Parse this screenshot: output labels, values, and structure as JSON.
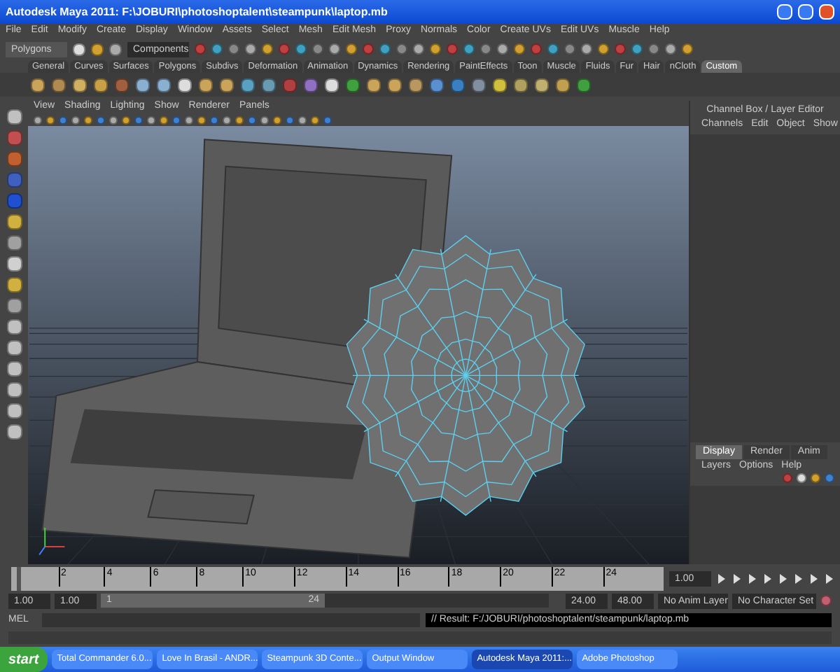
{
  "window": {
    "title": "Autodesk Maya 2011: F:\\JOBURI\\photoshoptalent\\steampunk\\laptop.mb"
  },
  "menu": [
    "File",
    "Edit",
    "Modify",
    "Create",
    "Display",
    "Window",
    "Assets",
    "Select",
    "Mesh",
    "Edit Mesh",
    "Proxy",
    "Normals",
    "Color",
    "Create UVs",
    "Edit UVs",
    "Muscle",
    "Help"
  ],
  "status_line": {
    "mode": "Polygons",
    "selection_mask": "Components"
  },
  "shelf_tabs": [
    {
      "label": "General",
      "selected": false
    },
    {
      "label": "Curves",
      "selected": false
    },
    {
      "label": "Surfaces",
      "selected": false
    },
    {
      "label": "Polygons",
      "selected": false
    },
    {
      "label": "Subdivs",
      "selected": false
    },
    {
      "label": "Deformation",
      "selected": false
    },
    {
      "label": "Animation",
      "selected": false
    },
    {
      "label": "Dynamics",
      "selected": false
    },
    {
      "label": "Rendering",
      "selected": false
    },
    {
      "label": "PaintEffects",
      "selected": false
    },
    {
      "label": "Toon",
      "selected": false
    },
    {
      "label": "Muscle",
      "selected": false
    },
    {
      "label": "Fluids",
      "selected": false
    },
    {
      "label": "Fur",
      "selected": false
    },
    {
      "label": "Hair",
      "selected": false
    },
    {
      "label": "nCloth",
      "selected": false
    },
    {
      "label": "Custom",
      "selected": true
    }
  ],
  "viewport_menu": [
    "View",
    "Shading",
    "Lighting",
    "Show",
    "Renderer",
    "Panels"
  ],
  "channel_box": {
    "title": "Channel Box / Layer Editor",
    "menu": [
      "Channels",
      "Edit",
      "Object",
      "Show"
    ]
  },
  "layer_editor": {
    "tabs": [
      {
        "label": "Display",
        "selected": true
      },
      {
        "label": "Render",
        "selected": false
      },
      {
        "label": "Anim",
        "selected": false
      }
    ],
    "menu": [
      "Layers",
      "Options",
      "Help"
    ]
  },
  "timeline": {
    "ticks": [
      "2",
      "4",
      "6",
      "8",
      "10",
      "12",
      "14",
      "16",
      "18",
      "20",
      "22",
      "24"
    ],
    "current_time": "1.00",
    "level": 0
  },
  "range": {
    "start": "1.00",
    "range_start": "1.00",
    "slider_start": "1",
    "slider_end": "24",
    "level": 0.5,
    "range_end": "24.00",
    "end": "48.00",
    "anim_layer": "No Anim Layer",
    "character_set": "No Character Set"
  },
  "command_line": {
    "label": "MEL",
    "result": "// Result: F:/JOBURI/photoshoptalent/steampunk/laptop.mb"
  },
  "taskbar": {
    "start": "start",
    "items": [
      {
        "label": "Total Commander 6.0...",
        "selected": false
      },
      {
        "label": "Love In Brasil - ANDR...",
        "selected": false
      },
      {
        "label": "Steampunk 3D Conte...",
        "selected": false
      },
      {
        "label": "Output Window",
        "selected": false
      },
      {
        "label": "Autodesk Maya 2011:...",
        "selected": true
      },
      {
        "label": "Adobe Photoshop",
        "selected": false
      }
    ]
  }
}
